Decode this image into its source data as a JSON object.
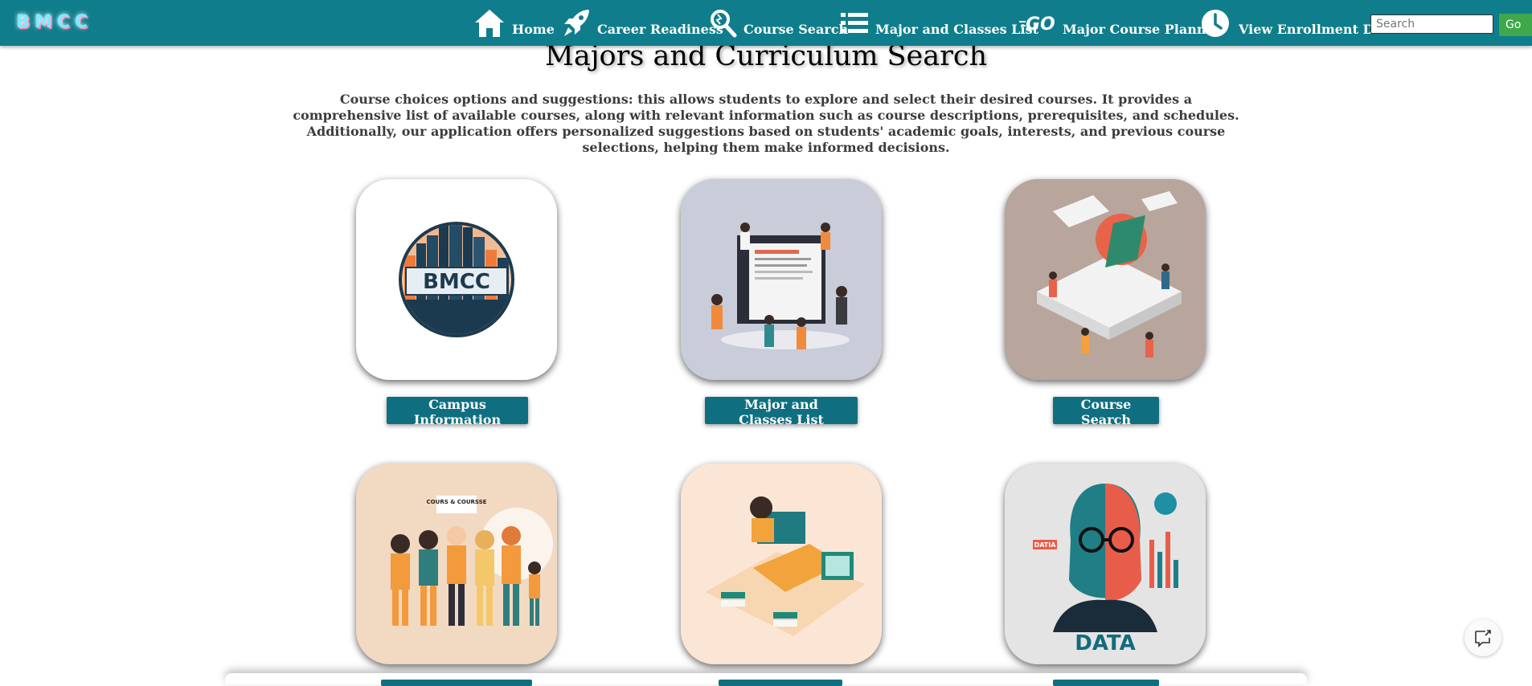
{
  "nav": {
    "logo_text": "BMCC",
    "items": [
      {
        "label": "Home",
        "icon": "home-icon"
      },
      {
        "label": "Career Readiness",
        "icon": "rocket-icon"
      },
      {
        "label": "Course Search",
        "icon": "magnifier-icon"
      },
      {
        "label": "Major and Classes List",
        "icon": "list-icon"
      },
      {
        "label": "Major Course Planner",
        "icon": "go-icon"
      },
      {
        "label": "View Enrollment Data",
        "icon": "clock-icon"
      }
    ],
    "search_placeholder": "Search",
    "go_label": "Go"
  },
  "page": {
    "title": "Majors and Curriculum Search",
    "intro": "Course choices options and suggestions: this allows students to explore and select their desired courses. It provides a comprehensive list of available courses, along with relevant information such as course descriptions, prerequisites, and schedules. Additionally, our application offers personalized suggestions based on students' academic goals, interests, and previous course selections, helping them make informed decisions."
  },
  "cards": [
    {
      "button": "Campus Information",
      "image": "bmcc-skyline-logo",
      "badge_text": "BMCC"
    },
    {
      "button": "Major and Classes List",
      "image": "students-around-screen-illustration"
    },
    {
      "button": "Course Search",
      "image": "isometric-school-illustration"
    },
    {
      "button": "",
      "image": "group-of-students-illustration",
      "sign_text": "COURS & COURSSE"
    },
    {
      "button": "",
      "image": "student-at-computer-illustration"
    },
    {
      "button": "",
      "image": "data-portrait-illustration",
      "caption_text": "DATA",
      "tag_text": "DATIA"
    }
  ],
  "colors": {
    "navbar": "#0f7d8c",
    "button": "#0f6f80",
    "go": "#3ea84a"
  }
}
